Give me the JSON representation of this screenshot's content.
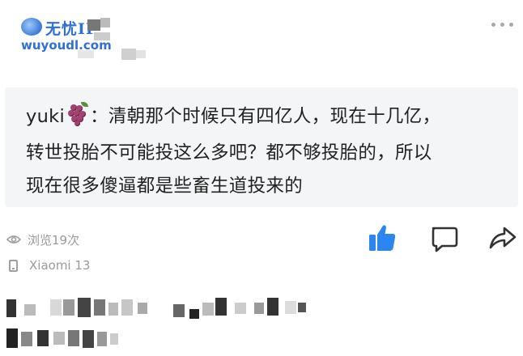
{
  "watermark": {
    "title": "无忧IP",
    "subtitle": "wuyoudl.com"
  },
  "post": {
    "quote_user": "yuki",
    "quote_lines": [
      "：清朝那个时候只有四亿人，现在十几亿，",
      "转世投胎不可能投这么多吧？都不够投胎的，所以",
      "现在很多傻逼都是些畜生道投来的"
    ]
  },
  "meta": {
    "views": "浏览19次",
    "device": "Xiaomi 13"
  },
  "icons": {
    "like": "thumbs-up-icon",
    "comment": "comment-icon",
    "share": "share-icon",
    "menu": "more-dots-icon",
    "views": "eye-icon",
    "device": "phone-icon"
  },
  "colors": {
    "like_blue": "#2b86f0",
    "quote_bg": "#f4f5f7",
    "text": "#222222",
    "meta_text": "#9a9a9a",
    "watermark_blue": "#2e6fd8"
  }
}
